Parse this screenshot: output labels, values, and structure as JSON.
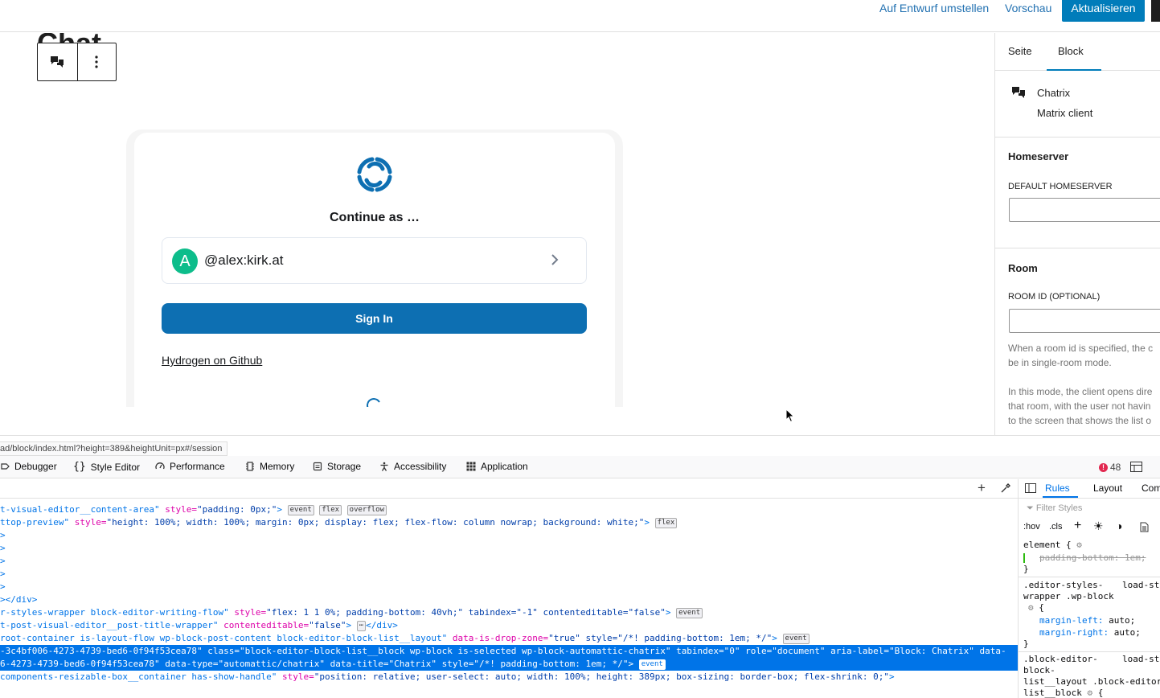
{
  "topbar": {
    "switch_to_draft": "Auf Entwurf umstellen",
    "preview": "Vorschau",
    "update": "Aktualisieren"
  },
  "editor": {
    "post_title": "Chat",
    "block_toolbar": {
      "block_icon": "chat-bubbles-icon",
      "options_icon": "vertical-dots-icon"
    }
  },
  "chat_client": {
    "logo_icon": "hydrogen-logo-icon",
    "title": "Continue as …",
    "account": {
      "avatar_letter": "A",
      "username": "@alex:kirk.at",
      "avatar_color": "#0dbd8b"
    },
    "sign_in": "Sign In",
    "github_link": "Hydrogen on Github"
  },
  "sidebar": {
    "tabs": {
      "page": "Seite",
      "block": "Block"
    },
    "block_card": {
      "name": "Chatrix",
      "description": "Matrix client"
    },
    "homeserver": {
      "heading": "Homeserver",
      "label": "DEFAULT HOMESERVER",
      "value": ""
    },
    "room": {
      "heading": "Room",
      "label": "ROOM ID (OPTIONAL)",
      "value": "",
      "help1_line1": "When a room id is specified, the c",
      "help1_line2": "be in single-room mode.",
      "help2_line1": "In this mode, the client opens dire",
      "help2_line2": "that room, with the user not havin",
      "help2_line3": "to the screen that shows the list o"
    }
  },
  "devtools": {
    "status_url": "ad/block/index.html?height=389&heightUnit=px#/session",
    "tabs": [
      "Debugger",
      "Style Editor",
      "Performance",
      "Memory",
      "Storage",
      "Accessibility",
      "Application"
    ],
    "error_count": "48",
    "inspector_lines": [
      {
        "tag": "t-visual-editor__content-area\"",
        "attr": " style=",
        "val": "\"padding: 0px;\"",
        "end": ">",
        "badges": [
          "event",
          "flex",
          "overflow"
        ]
      },
      {
        "tag": "ttop-preview\"",
        "attr": " style=",
        "val": "\"height: 100%; width: 100%; margin: 0px; display: flex; flex-flow: column nowrap; background: white;\"",
        "end": ">",
        "badges": [
          "flex"
        ]
      },
      {
        "tag": ">",
        "attr": "",
        "val": "",
        "end": "",
        "badges": []
      },
      {
        "tag": ">",
        "attr": "",
        "val": "",
        "end": "",
        "badges": []
      },
      {
        "tag": ">",
        "attr": "",
        "val": "",
        "end": "",
        "badges": []
      },
      {
        "tag": ">",
        "attr": "",
        "val": "",
        "end": "",
        "badges": []
      },
      {
        "tag": ">",
        "attr": "",
        "val": "",
        "end": "",
        "badges": []
      },
      {
        "tag": "></div>",
        "attr": "",
        "val": "",
        "end": "",
        "badges": []
      },
      {
        "tag": "r-styles-wrapper block-editor-writing-flow\"",
        "attr": " style=",
        "val": "\"flex: 1 1 0%; padding-bottom: 40vh;\" tabindex=\"-1\" contenteditable=\"false\"",
        "end": ">",
        "badges": [
          "event"
        ]
      },
      {
        "tag": "t-post-visual-editor__post-title-wrapper\"",
        "attr": " contenteditable=",
        "val": "\"false\"",
        "end": ">",
        "badges": [
          "⋯"
        ],
        "tail": "</div>"
      },
      {
        "tag": "root-container is-layout-flow wp-block-post-content block-editor-block-list__layout\"",
        "attr": " data-is-drop-zone=",
        "val": "\"true\" style=\"/*! padding-bottom: 1em; */\"",
        "end": ">",
        "badges": [
          "event"
        ]
      },
      {
        "tag": "-3c4bf006-4273-4739-bed6-0f94f53cea78\" class=\"block-editor-block-list__block wp-block is-selected wp-block-automattic-chatrix\" tabindex=\"0\" role=\"document\" aria-label=\"Block: Chatrix\" data-",
        "attr": "",
        "val": "",
        "end": "",
        "badges": [],
        "selected": true
      },
      {
        "tag": "6-4273-4739-bed6-0f94f53cea78\" data-type=\"automattic/chatrix\" data-title=\"Chatrix\" style=\"/*! padding-bottom: 1em; */\">",
        "attr": "",
        "val": "",
        "end": "",
        "badges": [
          "event"
        ],
        "selected": true
      },
      {
        "tag": "components-resizable-box__container has-show-handle\"",
        "attr": " style=",
        "val": "\"position: relative; user-select: auto; width: 100%; height: 389px; box-sizing: border-box; flex-shrink: 0;\"",
        "end": ">",
        "badges": []
      }
    ],
    "rules_tabs": {
      "rules": "Rules",
      "layout": "Layout",
      "computed": "Com"
    },
    "filter_placeholder": "Filter Styles",
    "rules_tools": {
      "hov": ":hov",
      "cls": ".cls"
    },
    "rules": {
      "r1_selector": "element {",
      "r1_prop": "padding-bottom: 1em;",
      "r1_close": "}",
      "r2_selector_a": ".editor-styles-",
      "r2_source": "load-sty",
      "r2_selector_b": "wrapper .wp-block",
      "r2_open": "{",
      "r2_prop1_name": "margin-left:",
      "r2_prop1_val": "auto;",
      "r2_prop2_name": "margin-right:",
      "r2_prop2_val": "auto;",
      "r2_close": "}",
      "r3_selector_a": ".block-editor-",
      "r3_source": "load-sty",
      "r3_selector_b": "block-",
      "r3_selector_c": "list__layout .block-editor",
      "r3_selector_d": "list__block",
      "r3_open": "{"
    }
  }
}
